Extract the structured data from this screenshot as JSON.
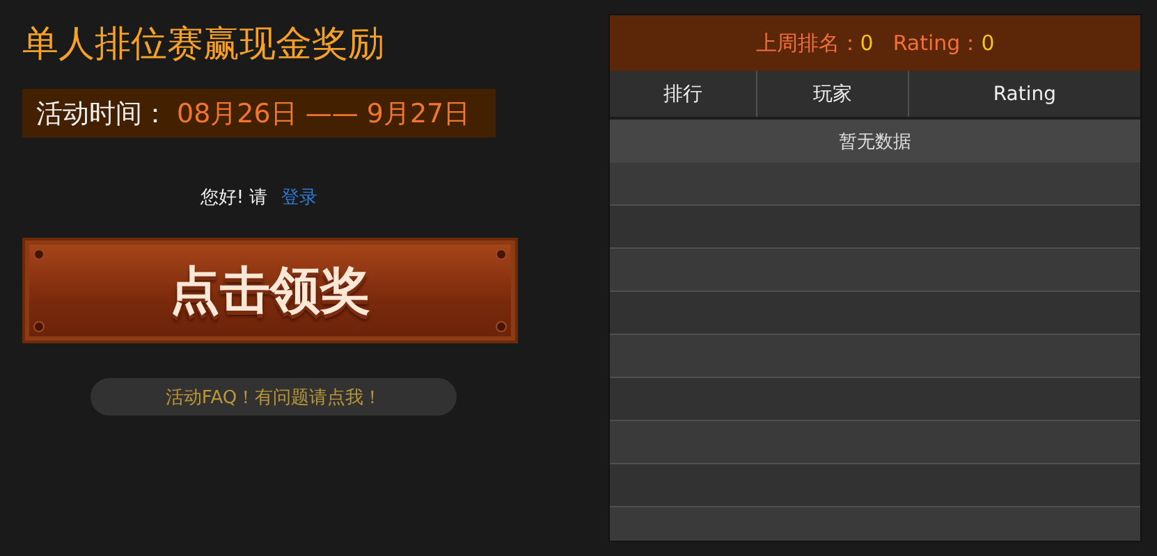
{
  "title": "单人排位赛赢现金奖励",
  "period": {
    "label": "活动时间：",
    "start": "08月26日",
    "separator": "——",
    "end": "9月27日"
  },
  "greeting": {
    "text": "您好! 请",
    "link": "登录"
  },
  "claim_button": "点击领奖",
  "faq_button": "活动FAQ！有问题请点我！",
  "leaderboard": {
    "summary": [
      {
        "label": "上周排名：",
        "value": "0"
      },
      {
        "label": "Rating：",
        "value": "0"
      }
    ],
    "columns": [
      "排行",
      "玩家",
      "Rating"
    ],
    "empty_message": "暂无数据"
  }
}
